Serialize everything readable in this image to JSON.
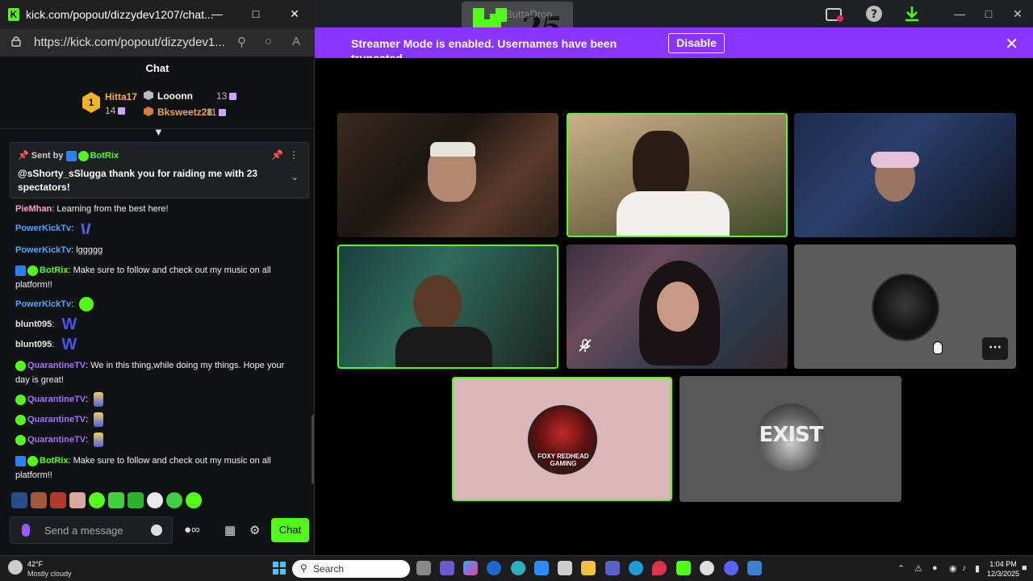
{
  "chat_window": {
    "title": "kick.com/popout/dizzydev1207/chat...",
    "url": "https://kick.com/popout/dizzydev1...",
    "header": "Chat",
    "leaderboard": {
      "rank_badge": "1",
      "entries": [
        {
          "name": "Hitta17",
          "count": "14",
          "color": "#f0b429"
        },
        {
          "name": "Looonn",
          "count": "13",
          "color": "#ffffff"
        },
        {
          "name": "Bksweetz28",
          "count": "11",
          "color": "#f0a050"
        }
      ]
    },
    "pinned": {
      "sent_by_label": "Sent by",
      "sender": "BotRix",
      "text": "@sShorty_sSlugga thank you for raiding me with 23 spectators!"
    },
    "messages": [
      {
        "user": "PieMhan",
        "text": "Learning from the best here!"
      },
      {
        "user": "PowerKickTv",
        "text": ""
      },
      {
        "user": "PowerKickTv",
        "text": "lggggg"
      },
      {
        "user": "BotRix",
        "text": "Make sure to follow and check out my music on all platform!!"
      },
      {
        "user": "PowerKickTv",
        "text": ""
      },
      {
        "user": "blunt095",
        "text": "W"
      },
      {
        "user": "blunt095",
        "text": "W"
      },
      {
        "user": "QuarantineTV",
        "text": "We in this thing,while doing my things. Hope your day is great!"
      },
      {
        "user": "QuarantineTV",
        "text": ""
      },
      {
        "user": "QuarantineTV",
        "text": ""
      },
      {
        "user": "QuarantineTV",
        "text": ""
      },
      {
        "user": "BotRix",
        "text": "Make sure to follow and check out my music on all platform!!"
      }
    ],
    "input_placeholder": "Send a message",
    "send_label": "Chat"
  },
  "main_window": {
    "tab_text": "ButtaDrop...",
    "logo_text": "25",
    "banner": {
      "message": "Streamer Mode is enabled. Usernames have been truncated.",
      "disable_label": "Disable"
    },
    "tiles": [
      {
        "name": "streamer-1",
        "active": false
      },
      {
        "name": "streamer-2",
        "active": true
      },
      {
        "name": "streamer-3",
        "active": false
      },
      {
        "name": "streamer-4",
        "active": true
      },
      {
        "name": "streamer-5",
        "active": false,
        "muted": true
      },
      {
        "name": "streamer-6",
        "active": false,
        "avatar": true
      },
      {
        "name": "foxy-redhead",
        "active": true,
        "avatar_text": "FOXY REDHEAD GAMING"
      },
      {
        "name": "exist",
        "active": false,
        "avatar_text": "EXIST"
      }
    ]
  },
  "taskbar": {
    "weather_temp": "42°F",
    "weather_cond": "Mostly cloudy",
    "search_placeholder": "Search",
    "time": "1:04 PM",
    "date": "12/3/2025"
  },
  "colors": {
    "kick_green": "#53fc18",
    "streamer_banner": "#8a35ff",
    "chat_bg": "#111214"
  }
}
